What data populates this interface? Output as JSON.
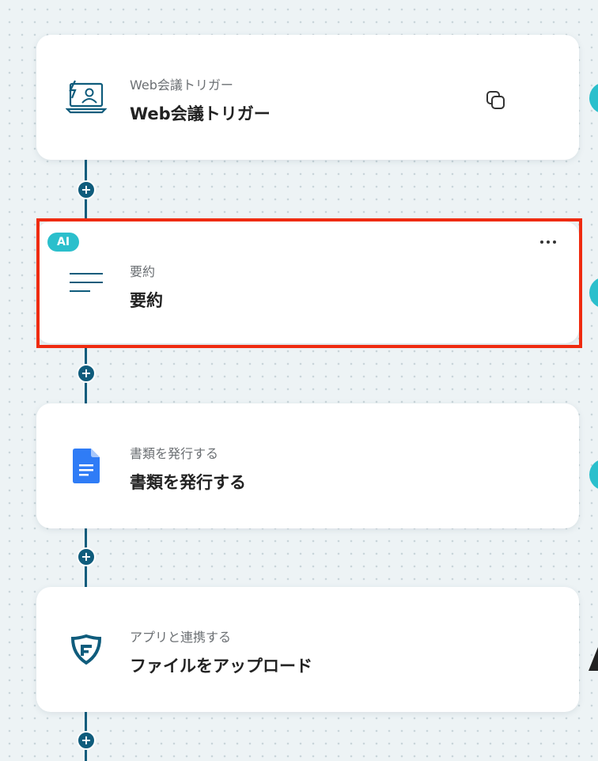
{
  "cards": [
    {
      "id": "web-meeting-trigger",
      "subtitle": "Web会議トリガー",
      "title": "Web会議トリガー",
      "icon": "video-conference-icon"
    },
    {
      "id": "summary",
      "badge": "AI",
      "subtitle": "要約",
      "title": "要約",
      "icon": "text-lines-icon"
    },
    {
      "id": "issue-document",
      "subtitle": "書類を発行する",
      "title": "書類を発行する",
      "icon": "google-docs-icon"
    },
    {
      "id": "app-integration",
      "subtitle": "アプリと連携する",
      "title": "ファイルをアップロード",
      "icon": "app-logo-icon"
    }
  ],
  "controls": {
    "copy_icon": "copy-icon",
    "more_icon": "more-options-icon",
    "add_icon": "plus-icon",
    "add_label": "+"
  },
  "colors": {
    "connector": "#0f5c7c",
    "accent": "#2bbfcc",
    "highlight": "#ef2b10",
    "docs_blue": "#2f7cf6"
  }
}
